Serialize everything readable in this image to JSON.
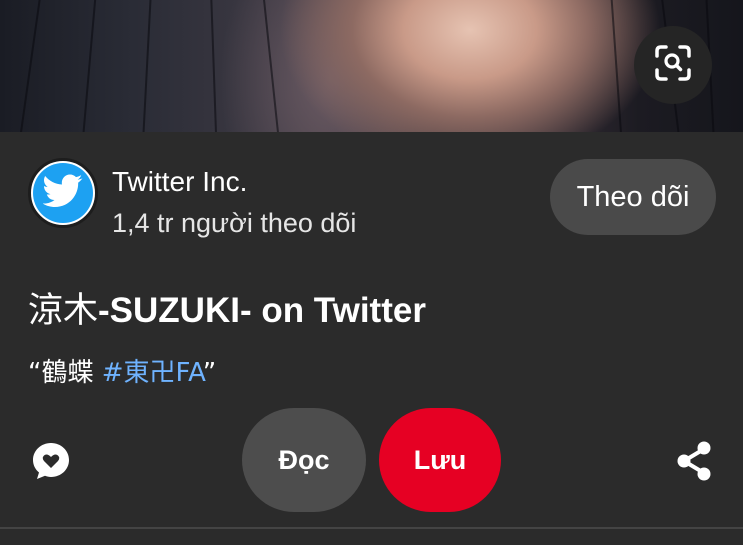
{
  "profile": {
    "name": "Twitter Inc.",
    "followers": "1,4 tr người theo dõi",
    "follow_label": "Theo dõi"
  },
  "pin": {
    "title_prefix": "涼木",
    "title_rest": "-SUZUKI- on Twitter",
    "desc_open_quote": "“",
    "desc_text": "鶴蝶 ",
    "desc_hashtag": "#東卍FA",
    "desc_close_quote": "”"
  },
  "actions": {
    "read_label": "Đọc",
    "save_label": "Lưu"
  },
  "colors": {
    "background": "#2b2b2b",
    "save": "#e60023",
    "hashtag": "#6fb3ff",
    "twitter_blue": "#1da1f2"
  },
  "icons": {
    "lens": "visual-search-icon",
    "avatar": "twitter-bird-icon",
    "comment": "comment-heart-icon",
    "share": "share-icon"
  }
}
